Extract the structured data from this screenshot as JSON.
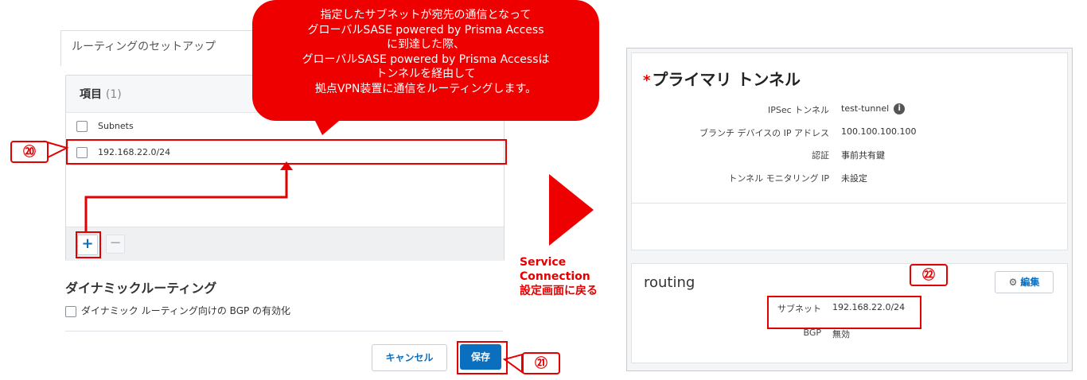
{
  "callout_message": {
    "lines": [
      "指定したサブネットが宛先の通信となって",
      "グローバルSASE powered by Prisma Access",
      "に到達した際、",
      "グローバルSASE powered by Prisma Accessは",
      "トンネルを経由して",
      "拠点VPN装置に通信をルーティングします。"
    ],
    "color": "#ee0000"
  },
  "routing_setup": {
    "tab_label": "ルーティングのセットアップ",
    "items_title": "項目",
    "items_count": "(1)",
    "column_header": "Subnets",
    "rows": [
      {
        "subnet": "192.168.22.0/24"
      }
    ],
    "add_icon": "plus-icon",
    "remove_icon": "minus-icon"
  },
  "dynamic_routing": {
    "title": "ダイナミックルーティング",
    "bgp_checkbox_label": "ダイナミック ルーティング向けの BGP の有効化"
  },
  "buttons": {
    "cancel": "キャンセル",
    "save": "保存"
  },
  "markers": {
    "m20": "⑳",
    "m21": "㉑",
    "m22": "㉒"
  },
  "service_connection_label": [
    "Service",
    "Connection",
    "設定画面に戻る"
  ],
  "primary_tunnel": {
    "title": "プライマリ トンネル",
    "required_mark": "*",
    "fields": [
      {
        "label": "IPSec トンネル",
        "value": "test-tunnel"
      },
      {
        "label": "ブランチ デバイスの IP アドレス",
        "value": "100.100.100.100"
      },
      {
        "label": "認証",
        "value": "事前共有鍵"
      },
      {
        "label": "トンネル モニタリング IP",
        "value": "未設定"
      }
    ]
  },
  "routing": {
    "title": "routing",
    "edit_button": "編集",
    "fields": [
      {
        "label": "サブネット",
        "value": "192.168.22.0/24"
      },
      {
        "label": "BGP",
        "value": "無効"
      }
    ]
  },
  "colors": {
    "accent_red": "#e40000",
    "primary_blue": "#0a6fbf"
  }
}
